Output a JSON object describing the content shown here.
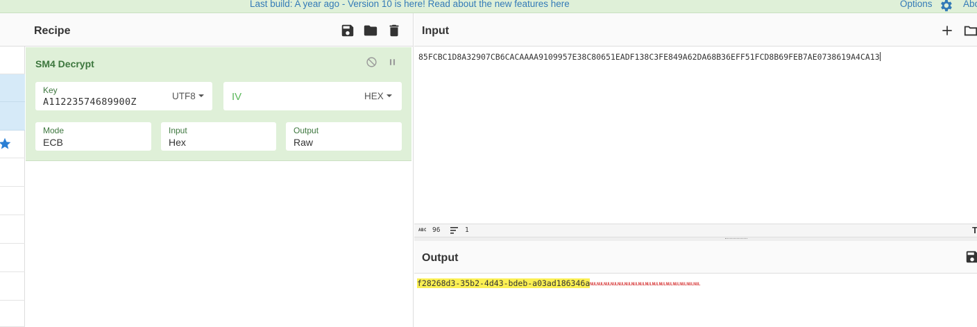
{
  "banner": {
    "text": "Last build: A year ago - Version 10 is here! Read about the new features here",
    "options_label": "Options",
    "about_label": "Abo"
  },
  "recipe": {
    "title": "Recipe",
    "operation": {
      "name": "SM4 Decrypt",
      "key_label": "Key",
      "key_value": "A11223574689900Z",
      "key_encoding": "UTF8",
      "iv_placeholder": "IV",
      "iv_encoding": "HEX",
      "mode_label": "Mode",
      "mode_value": "ECB",
      "input_label": "Input",
      "input_value": "Hex",
      "output_label": "Output",
      "output_value": "Raw"
    }
  },
  "input": {
    "title": "Input",
    "text": "85FCBC1D8A32907CB6CACAAAA9109957E38C80651EADF138C3FE849A62DA68B36EFF51FCD8B69FEB7AE0738619A4CA13",
    "length_icon": "ABC",
    "length": "96",
    "lines": "1",
    "t_label": "T"
  },
  "output": {
    "title": "Output",
    "text": "f28268d3-35b2-4d43-bdeb-a03ad186346a",
    "nul_chars": "NULNULNULNULNULNULNULNULNULNULNULNULNULNULNULNUL"
  },
  "colors": {
    "banner_bg": "#dff0d8",
    "link": "#337ab7",
    "op_card_bg": "#dff0d8",
    "op_title": "#3c763d",
    "selected_row": "#d6eaf8",
    "output_highlight": "#fbf053",
    "nul_color": "#cc0000"
  }
}
